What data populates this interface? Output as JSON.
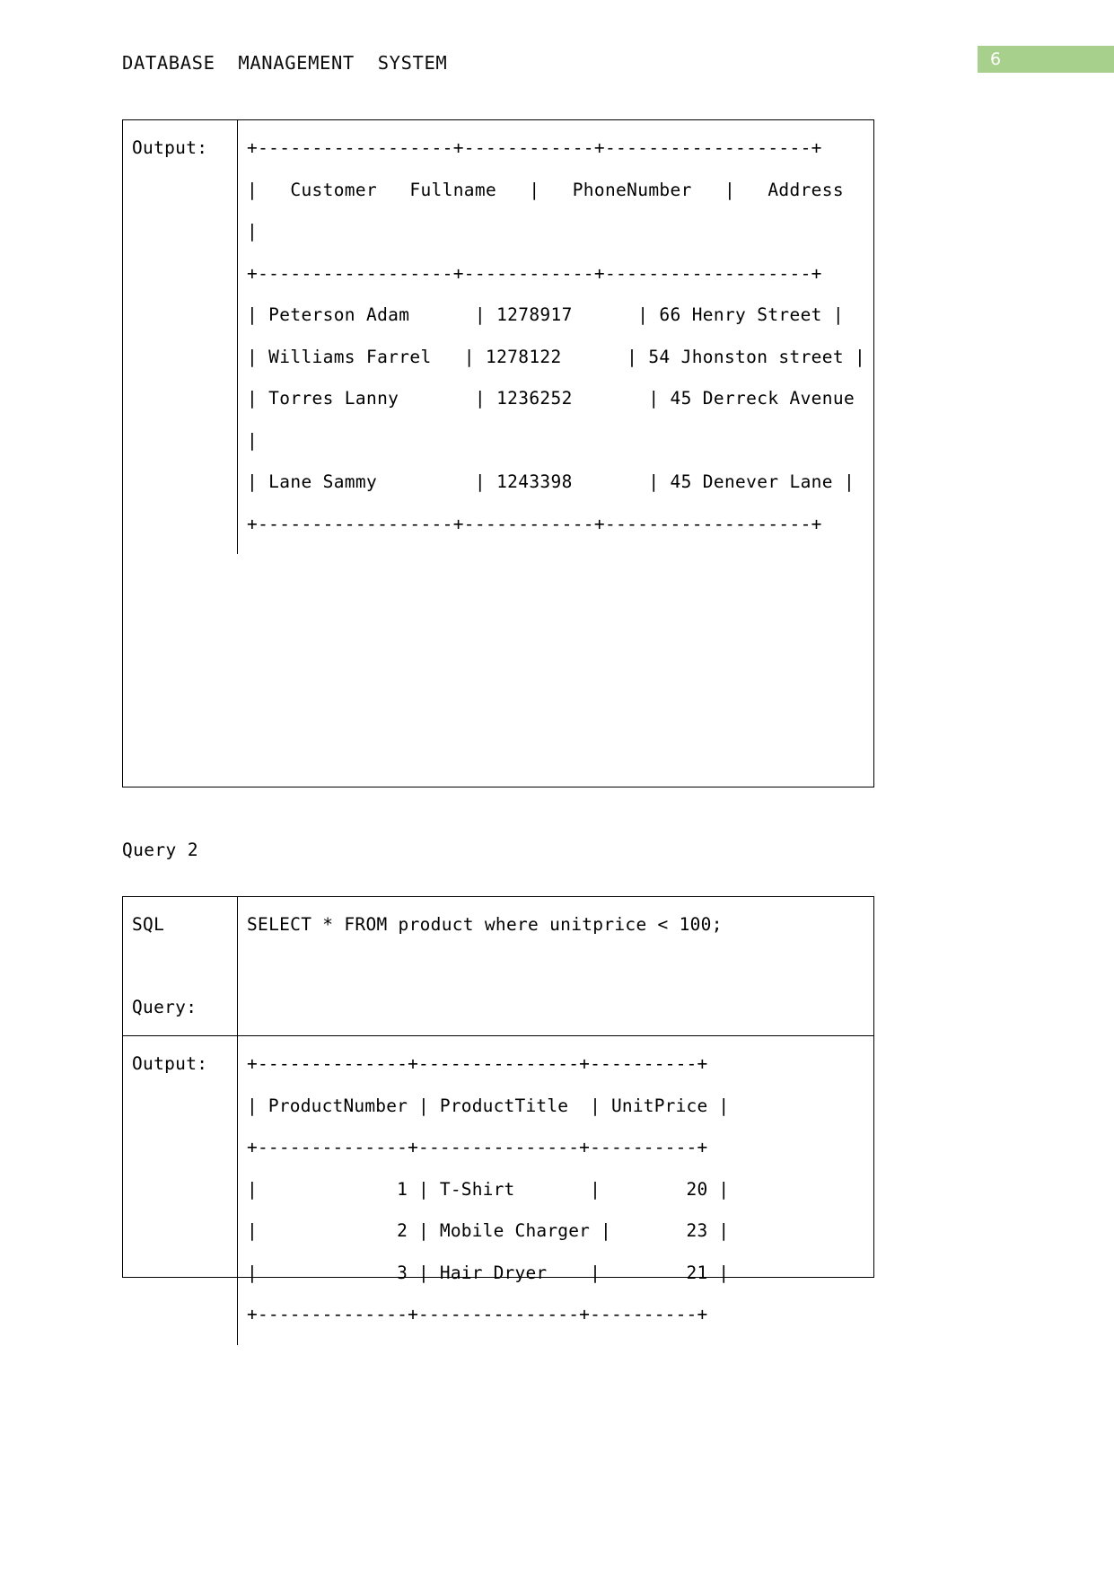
{
  "document": {
    "header_title": "DATABASE  MANAGEMENT  SYSTEM",
    "page_number": "6",
    "accent_color": "#a8d08d"
  },
  "query_1": {
    "output_label": "Output:",
    "output_text": "+------------------+------------+-------------------+\n|   Customer   Fullname   |   PhoneNumber   |   Address  |\n+------------------+------------+-------------------+\n| Peterson Adam      | 1278917      | 66 Henry Street |\n| Williams Farrel   | 1278122      | 54 Jhonston street |\n| Torres Lanny       | 1236252       | 45 Derreck Avenue |\n| Lane Sammy         | 1243398       | 45 Denever Lane |\n+------------------+------------+-------------------+",
    "columns": [
      "Customer Fullname",
      "PhoneNumber",
      "Address"
    ],
    "rows": [
      [
        "Peterson Adam",
        "1278917",
        "66 Henry Street"
      ],
      [
        "Williams Farrel",
        "1278122",
        "54 Jhonston street"
      ],
      [
        "Torres Lanny",
        "1236252",
        "45 Derreck Avenue"
      ],
      [
        "Lane Sammy",
        "1243398",
        "45 Denever Lane"
      ]
    ]
  },
  "query_2": {
    "caption": "Query 2",
    "sql_label": "SQL\n\nQuery:",
    "sql_query": "SELECT * FROM product where unitprice < 100;",
    "output_label": "Output:",
    "output_text": "+--------------+---------------+----------+\n| ProductNumber | ProductTitle  | UnitPrice |\n+--------------+---------------+----------+\n|             1 | T-Shirt       |        20 |\n|             2 | Mobile Charger |       23 |\n|             3 | Hair Dryer    |        21 |\n+--------------+---------------+----------+",
    "columns": [
      "ProductNumber",
      "ProductTitle",
      "UnitPrice"
    ],
    "rows": [
      [
        "1",
        "T-Shirt",
        "20"
      ],
      [
        "2",
        "Mobile Charger",
        "23"
      ],
      [
        "3",
        "Hair Dryer",
        "21"
      ]
    ]
  }
}
